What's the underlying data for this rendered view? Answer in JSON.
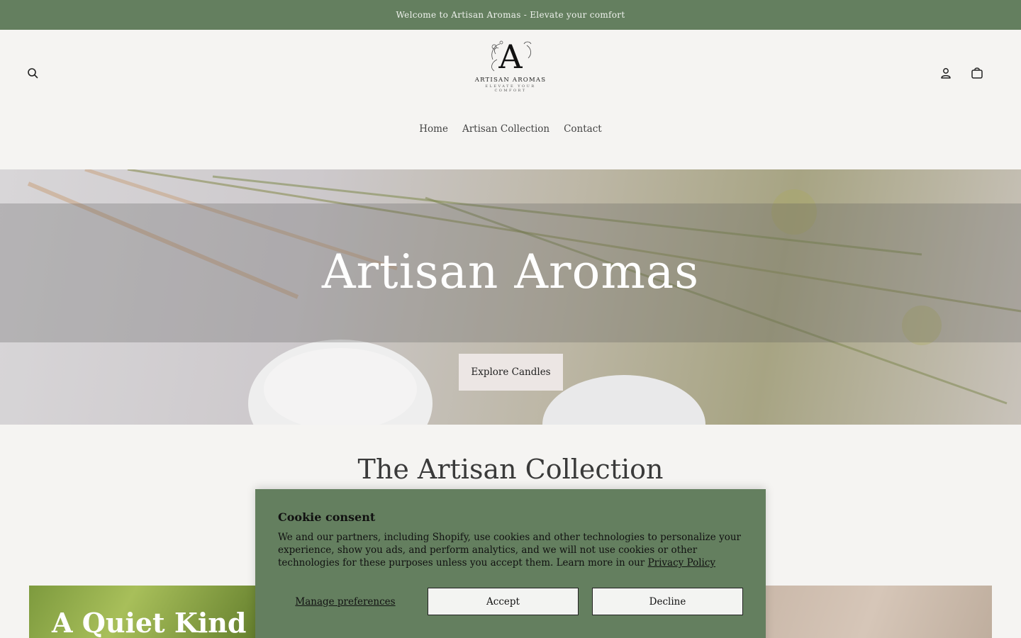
{
  "announcement": "Welcome to Artisan Aromas - Elevate your comfort",
  "header": {
    "logo": {
      "mark": "A",
      "brand": "ARTISAN AROMAS",
      "tagline": "ELEVATE YOUR COMFORT"
    },
    "icons": {
      "search": "search-icon",
      "account": "user-icon",
      "cart": "bag-icon"
    }
  },
  "nav": {
    "items": [
      {
        "label": "Home"
      },
      {
        "label": "Artisan Collection"
      },
      {
        "label": "Contact"
      }
    ]
  },
  "hero": {
    "title": "Artisan Aromas",
    "button": "Explore Candles"
  },
  "collection": {
    "title": "The Artisan Collection",
    "card_title": "A Quiet Kind of"
  },
  "cookie": {
    "title": "Cookie consent",
    "body": "We and our partners, including Shopify, use cookies and other technologies to personalize your experience, show you ads, and perform analytics, and we will not use cookies or other technologies for these purposes unless you accept them. Learn more in our ",
    "link": "Privacy Policy",
    "manage": "Manage preferences",
    "accept": "Accept",
    "decline": "Decline"
  },
  "colors": {
    "accent": "#647f5f",
    "background": "#f5f4f2"
  }
}
